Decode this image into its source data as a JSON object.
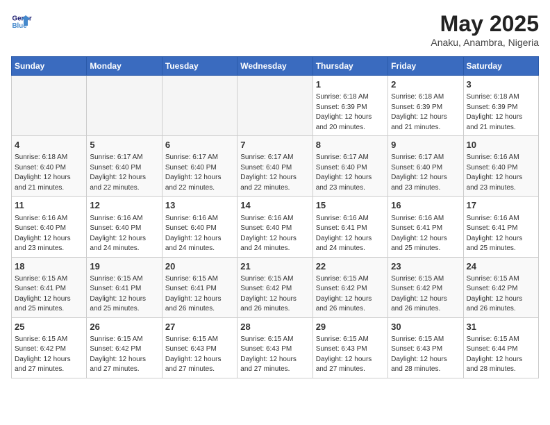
{
  "logo": {
    "line1": "General",
    "line2": "Blue"
  },
  "title": "May 2025",
  "subtitle": "Anaku, Anambra, Nigeria",
  "days_of_week": [
    "Sunday",
    "Monday",
    "Tuesday",
    "Wednesday",
    "Thursday",
    "Friday",
    "Saturday"
  ],
  "weeks": [
    [
      {
        "day": "",
        "info": ""
      },
      {
        "day": "",
        "info": ""
      },
      {
        "day": "",
        "info": ""
      },
      {
        "day": "",
        "info": ""
      },
      {
        "day": "1",
        "info": "Sunrise: 6:18 AM\nSunset: 6:39 PM\nDaylight: 12 hours\nand 20 minutes."
      },
      {
        "day": "2",
        "info": "Sunrise: 6:18 AM\nSunset: 6:39 PM\nDaylight: 12 hours\nand 21 minutes."
      },
      {
        "day": "3",
        "info": "Sunrise: 6:18 AM\nSunset: 6:39 PM\nDaylight: 12 hours\nand 21 minutes."
      }
    ],
    [
      {
        "day": "4",
        "info": "Sunrise: 6:18 AM\nSunset: 6:40 PM\nDaylight: 12 hours\nand 21 minutes."
      },
      {
        "day": "5",
        "info": "Sunrise: 6:17 AM\nSunset: 6:40 PM\nDaylight: 12 hours\nand 22 minutes."
      },
      {
        "day": "6",
        "info": "Sunrise: 6:17 AM\nSunset: 6:40 PM\nDaylight: 12 hours\nand 22 minutes."
      },
      {
        "day": "7",
        "info": "Sunrise: 6:17 AM\nSunset: 6:40 PM\nDaylight: 12 hours\nand 22 minutes."
      },
      {
        "day": "8",
        "info": "Sunrise: 6:17 AM\nSunset: 6:40 PM\nDaylight: 12 hours\nand 23 minutes."
      },
      {
        "day": "9",
        "info": "Sunrise: 6:17 AM\nSunset: 6:40 PM\nDaylight: 12 hours\nand 23 minutes."
      },
      {
        "day": "10",
        "info": "Sunrise: 6:16 AM\nSunset: 6:40 PM\nDaylight: 12 hours\nand 23 minutes."
      }
    ],
    [
      {
        "day": "11",
        "info": "Sunrise: 6:16 AM\nSunset: 6:40 PM\nDaylight: 12 hours\nand 23 minutes."
      },
      {
        "day": "12",
        "info": "Sunrise: 6:16 AM\nSunset: 6:40 PM\nDaylight: 12 hours\nand 24 minutes."
      },
      {
        "day": "13",
        "info": "Sunrise: 6:16 AM\nSunset: 6:40 PM\nDaylight: 12 hours\nand 24 minutes."
      },
      {
        "day": "14",
        "info": "Sunrise: 6:16 AM\nSunset: 6:40 PM\nDaylight: 12 hours\nand 24 minutes."
      },
      {
        "day": "15",
        "info": "Sunrise: 6:16 AM\nSunset: 6:41 PM\nDaylight: 12 hours\nand 24 minutes."
      },
      {
        "day": "16",
        "info": "Sunrise: 6:16 AM\nSunset: 6:41 PM\nDaylight: 12 hours\nand 25 minutes."
      },
      {
        "day": "17",
        "info": "Sunrise: 6:16 AM\nSunset: 6:41 PM\nDaylight: 12 hours\nand 25 minutes."
      }
    ],
    [
      {
        "day": "18",
        "info": "Sunrise: 6:15 AM\nSunset: 6:41 PM\nDaylight: 12 hours\nand 25 minutes."
      },
      {
        "day": "19",
        "info": "Sunrise: 6:15 AM\nSunset: 6:41 PM\nDaylight: 12 hours\nand 25 minutes."
      },
      {
        "day": "20",
        "info": "Sunrise: 6:15 AM\nSunset: 6:41 PM\nDaylight: 12 hours\nand 26 minutes."
      },
      {
        "day": "21",
        "info": "Sunrise: 6:15 AM\nSunset: 6:42 PM\nDaylight: 12 hours\nand 26 minutes."
      },
      {
        "day": "22",
        "info": "Sunrise: 6:15 AM\nSunset: 6:42 PM\nDaylight: 12 hours\nand 26 minutes."
      },
      {
        "day": "23",
        "info": "Sunrise: 6:15 AM\nSunset: 6:42 PM\nDaylight: 12 hours\nand 26 minutes."
      },
      {
        "day": "24",
        "info": "Sunrise: 6:15 AM\nSunset: 6:42 PM\nDaylight: 12 hours\nand 26 minutes."
      }
    ],
    [
      {
        "day": "25",
        "info": "Sunrise: 6:15 AM\nSunset: 6:42 PM\nDaylight: 12 hours\nand 27 minutes."
      },
      {
        "day": "26",
        "info": "Sunrise: 6:15 AM\nSunset: 6:42 PM\nDaylight: 12 hours\nand 27 minutes."
      },
      {
        "day": "27",
        "info": "Sunrise: 6:15 AM\nSunset: 6:43 PM\nDaylight: 12 hours\nand 27 minutes."
      },
      {
        "day": "28",
        "info": "Sunrise: 6:15 AM\nSunset: 6:43 PM\nDaylight: 12 hours\nand 27 minutes."
      },
      {
        "day": "29",
        "info": "Sunrise: 6:15 AM\nSunset: 6:43 PM\nDaylight: 12 hours\nand 27 minutes."
      },
      {
        "day": "30",
        "info": "Sunrise: 6:15 AM\nSunset: 6:43 PM\nDaylight: 12 hours\nand 28 minutes."
      },
      {
        "day": "31",
        "info": "Sunrise: 6:15 AM\nSunset: 6:44 PM\nDaylight: 12 hours\nand 28 minutes."
      }
    ]
  ]
}
